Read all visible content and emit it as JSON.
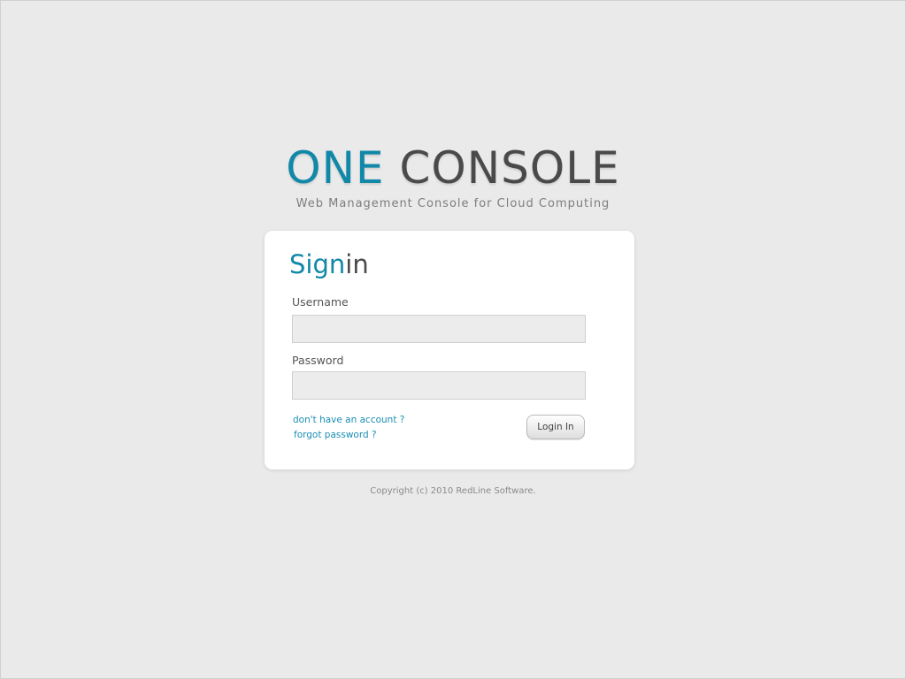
{
  "brand": {
    "logo_part1": "ONE",
    "logo_part2": "CONSOLE",
    "tagline": "Web Management Console for Cloud Computing"
  },
  "signin": {
    "title_part1": "Sign",
    "title_part2": "in",
    "username_label": "Username",
    "username_value": "",
    "password_label": "Password",
    "password_value": "",
    "no_account_link": "don't have an account ?",
    "forgot_password_link": "forgot password ?",
    "login_button": "Login In"
  },
  "footer": {
    "copyright": "Copyright (c) 2010 RedLine Software."
  },
  "colors": {
    "accent": "#1188a8",
    "dark_text": "#4a4a4a",
    "background": "#eaeaea",
    "link": "#1a8fb3"
  }
}
